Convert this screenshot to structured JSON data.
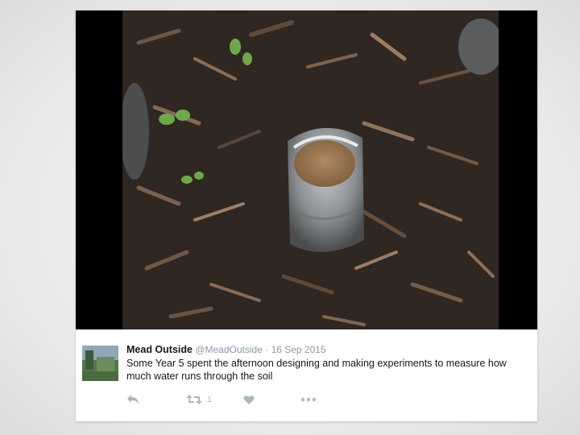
{
  "tweet": {
    "display_name": "Mead Outside",
    "handle": "@MeadOutside",
    "separator": "·",
    "date": "16 Sep 2015",
    "text": "Some Year 5 spent the afternoon designing and making experiments to measure how much water runs through the soil",
    "retweet_count": "1",
    "icons": {
      "reply": "reply-icon",
      "retweet": "retweet-icon",
      "like": "heart-icon",
      "more": "more-options-icon"
    }
  },
  "colors": {
    "card": "#ffffff",
    "text": "#14171a",
    "muted": "#8899a6",
    "icon": "#aab8c2",
    "media_background": "#000000"
  }
}
